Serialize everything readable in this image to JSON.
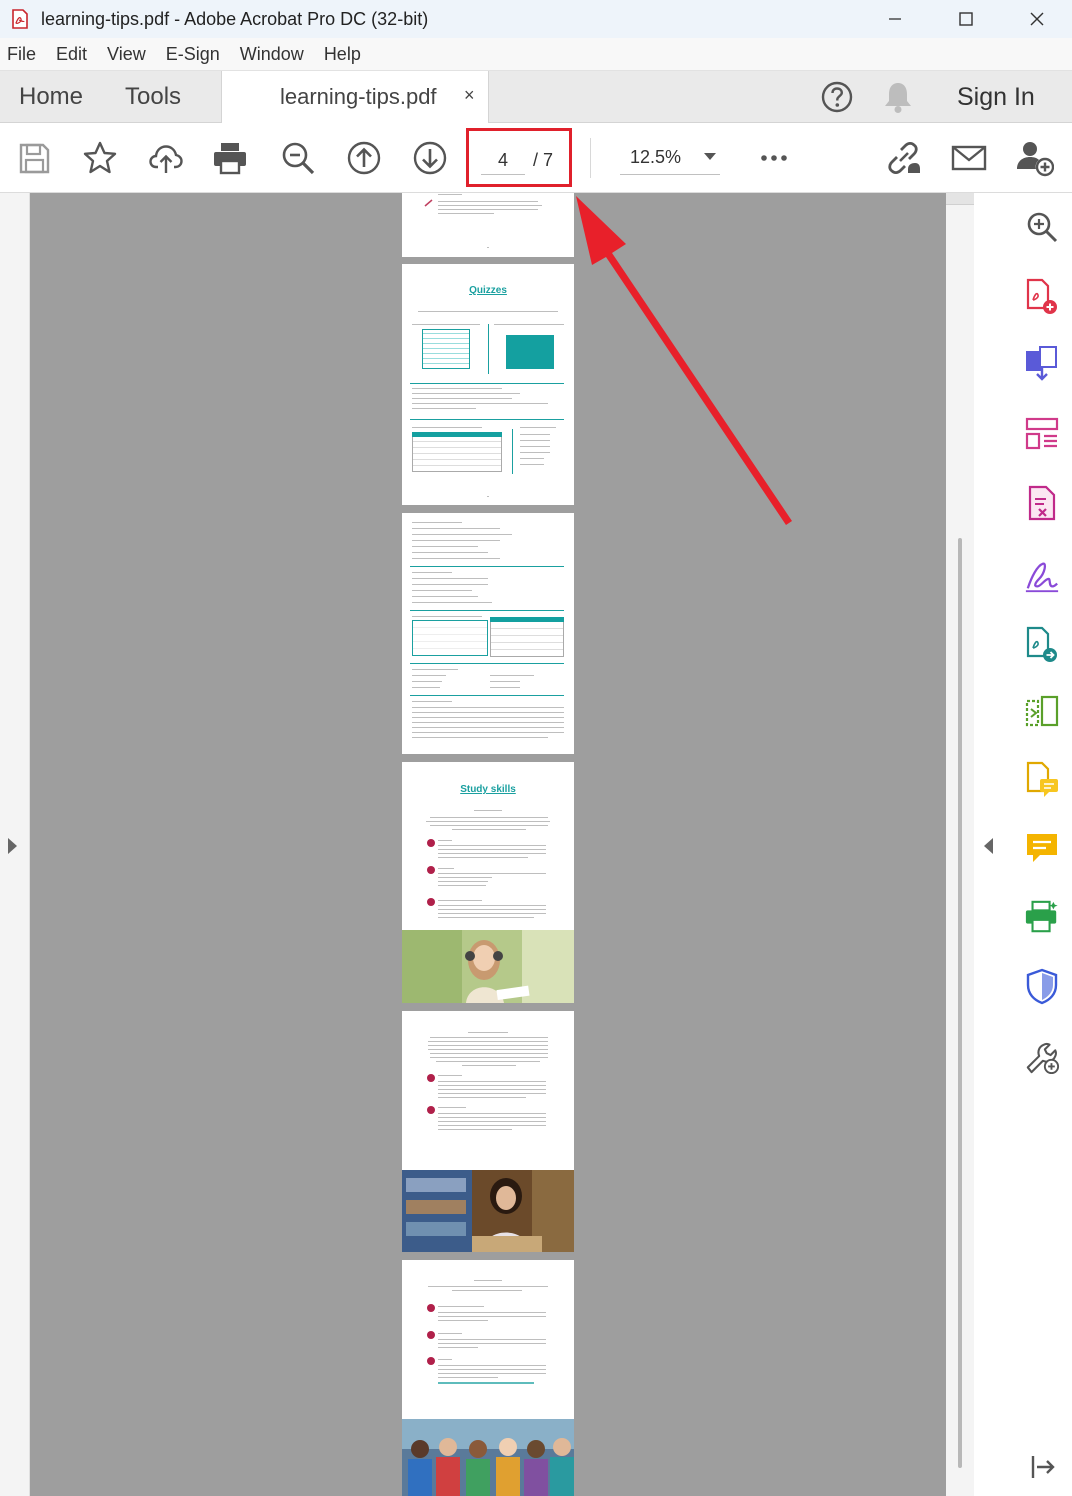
{
  "window": {
    "title": "learning-tips.pdf - Adobe Acrobat Pro DC (32-bit)",
    "minimize_label": "–",
    "maximize_label": "☐",
    "close_label": "✕"
  },
  "menu": [
    "File",
    "Edit",
    "View",
    "E-Sign",
    "Window",
    "Help"
  ],
  "tabs": {
    "home": "Home",
    "tools": "Tools",
    "document": "learning-tips.pdf",
    "close": "×",
    "sign_in": "Sign In"
  },
  "toolbar": {
    "page_current": "4",
    "page_total": "/ 7",
    "zoom": "12.5%"
  },
  "pages": {
    "quizzes_title": "Quizzes",
    "study_skills_title": "Study skills"
  },
  "colors": {
    "accent_red": "#e0202b",
    "teal": "#1aa0a0"
  }
}
